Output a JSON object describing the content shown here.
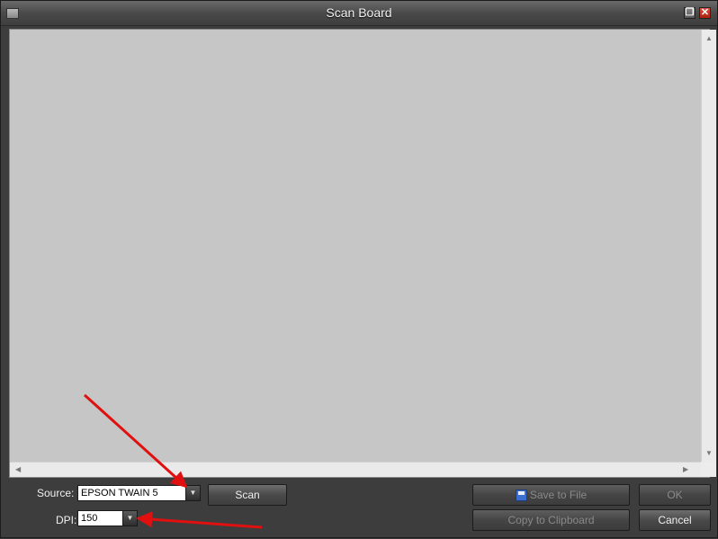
{
  "window": {
    "title": "Scan Board"
  },
  "source": {
    "label": "Source:",
    "value": "EPSON TWAIN 5"
  },
  "dpi": {
    "label": "DPI:",
    "value": "150"
  },
  "buttons": {
    "scan": "Scan",
    "save_to_file": "Save to File",
    "copy_to_clipboard": "Copy to Clipboard",
    "ok": "OK",
    "cancel": "Cancel"
  },
  "colors": {
    "arrow": "#e01010",
    "preview_bg": "#c6c6c6",
    "dialog_bg": "#3d3d3d"
  }
}
